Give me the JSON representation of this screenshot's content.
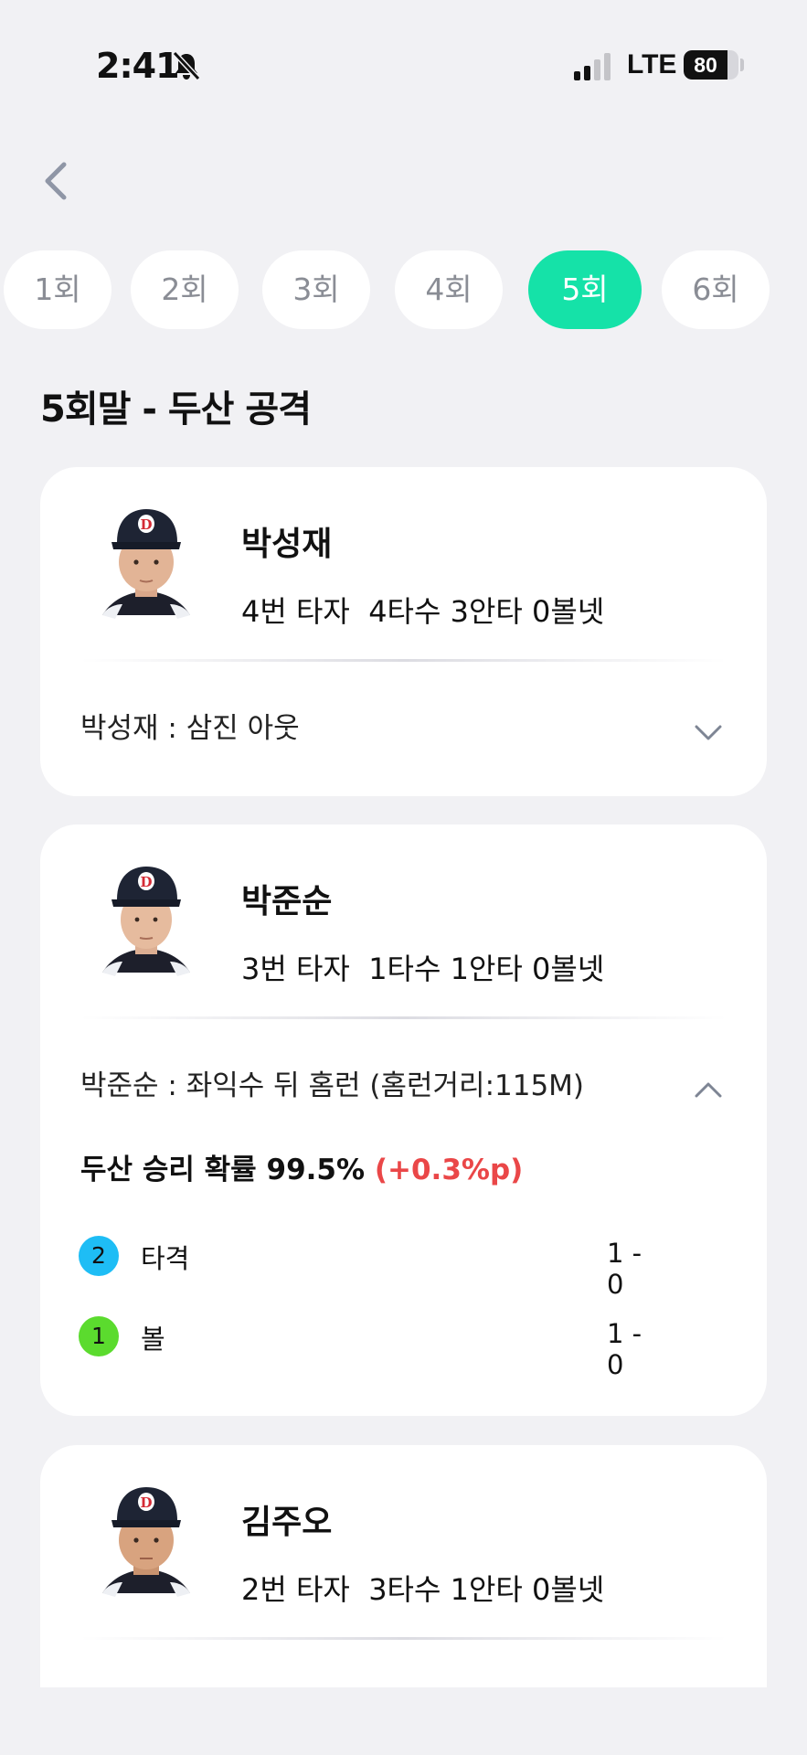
{
  "status_bar": {
    "time": "2:41",
    "network": "LTE",
    "battery": "80",
    "battery_level": 0.8
  },
  "innings": {
    "tabs": [
      "1회",
      "2회",
      "3회",
      "4회",
      "5회",
      "6회"
    ],
    "active_index": 4
  },
  "section_title": "5회말 - 두산 공격",
  "players": [
    {
      "name": "박성재",
      "stats": "4번 타자  4타수 3안타 0볼넷",
      "result": "박성재 : 삼진 아웃",
      "expanded": false
    },
    {
      "name": "박준순",
      "stats": "3번 타자  1타수 1안타 0볼넷",
      "result": "박준순 : 좌익수 뒤 홈런 (홈런거리:115M)",
      "expanded": true,
      "win_prob": "두산 승리 확률 99.5%",
      "win_delta": "(+0.3%p)",
      "pitches": [
        {
          "num": "2",
          "label": "타격",
          "count": "1 - 0",
          "color": "#1ebdf5"
        },
        {
          "num": "1",
          "label": "볼",
          "count": "1 - 0",
          "color": "#5bdb2e"
        }
      ]
    },
    {
      "name": "김주오",
      "stats": "2번 타자  3타수 1안타 0볼넷"
    }
  ],
  "colors": {
    "accent": "#15e2a8",
    "delta": "#ea4748",
    "background": "#f1f1f4"
  }
}
